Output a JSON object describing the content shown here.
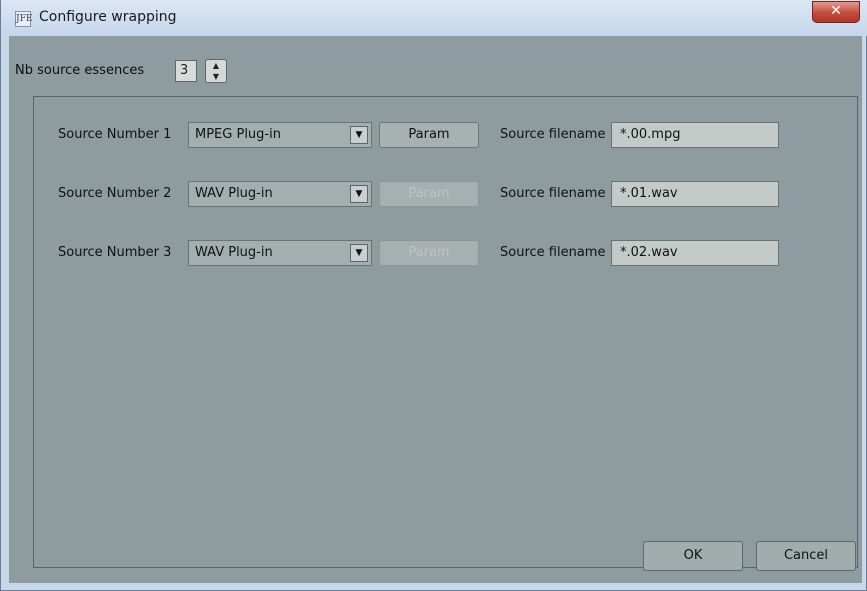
{
  "window": {
    "title": "Configure wrapping",
    "app_icon_label": "JFE"
  },
  "nb_source": {
    "label": "Nb source essences",
    "value": "3"
  },
  "rows": [
    {
      "label": "Source Number 1",
      "plugin": "MPEG Plug-in",
      "param": "Param",
      "param_enabled": true,
      "filename_label": "Source filename",
      "filename": "*.00.mpg"
    },
    {
      "label": "Source Number 2",
      "plugin": "WAV Plug-in",
      "param": "Param",
      "param_enabled": false,
      "filename_label": "Source filename",
      "filename": "*.01.wav"
    },
    {
      "label": "Source Number 3",
      "plugin": "WAV Plug-in",
      "param": "Param",
      "param_enabled": false,
      "filename_label": "Source filename",
      "filename": "*.02.wav"
    }
  ],
  "buttons": {
    "ok": "OK",
    "cancel": "Cancel"
  },
  "colors": {
    "client_bg": "#8f9c9f",
    "titlebar": "#c9d8e9",
    "close": "#c24b3c"
  }
}
